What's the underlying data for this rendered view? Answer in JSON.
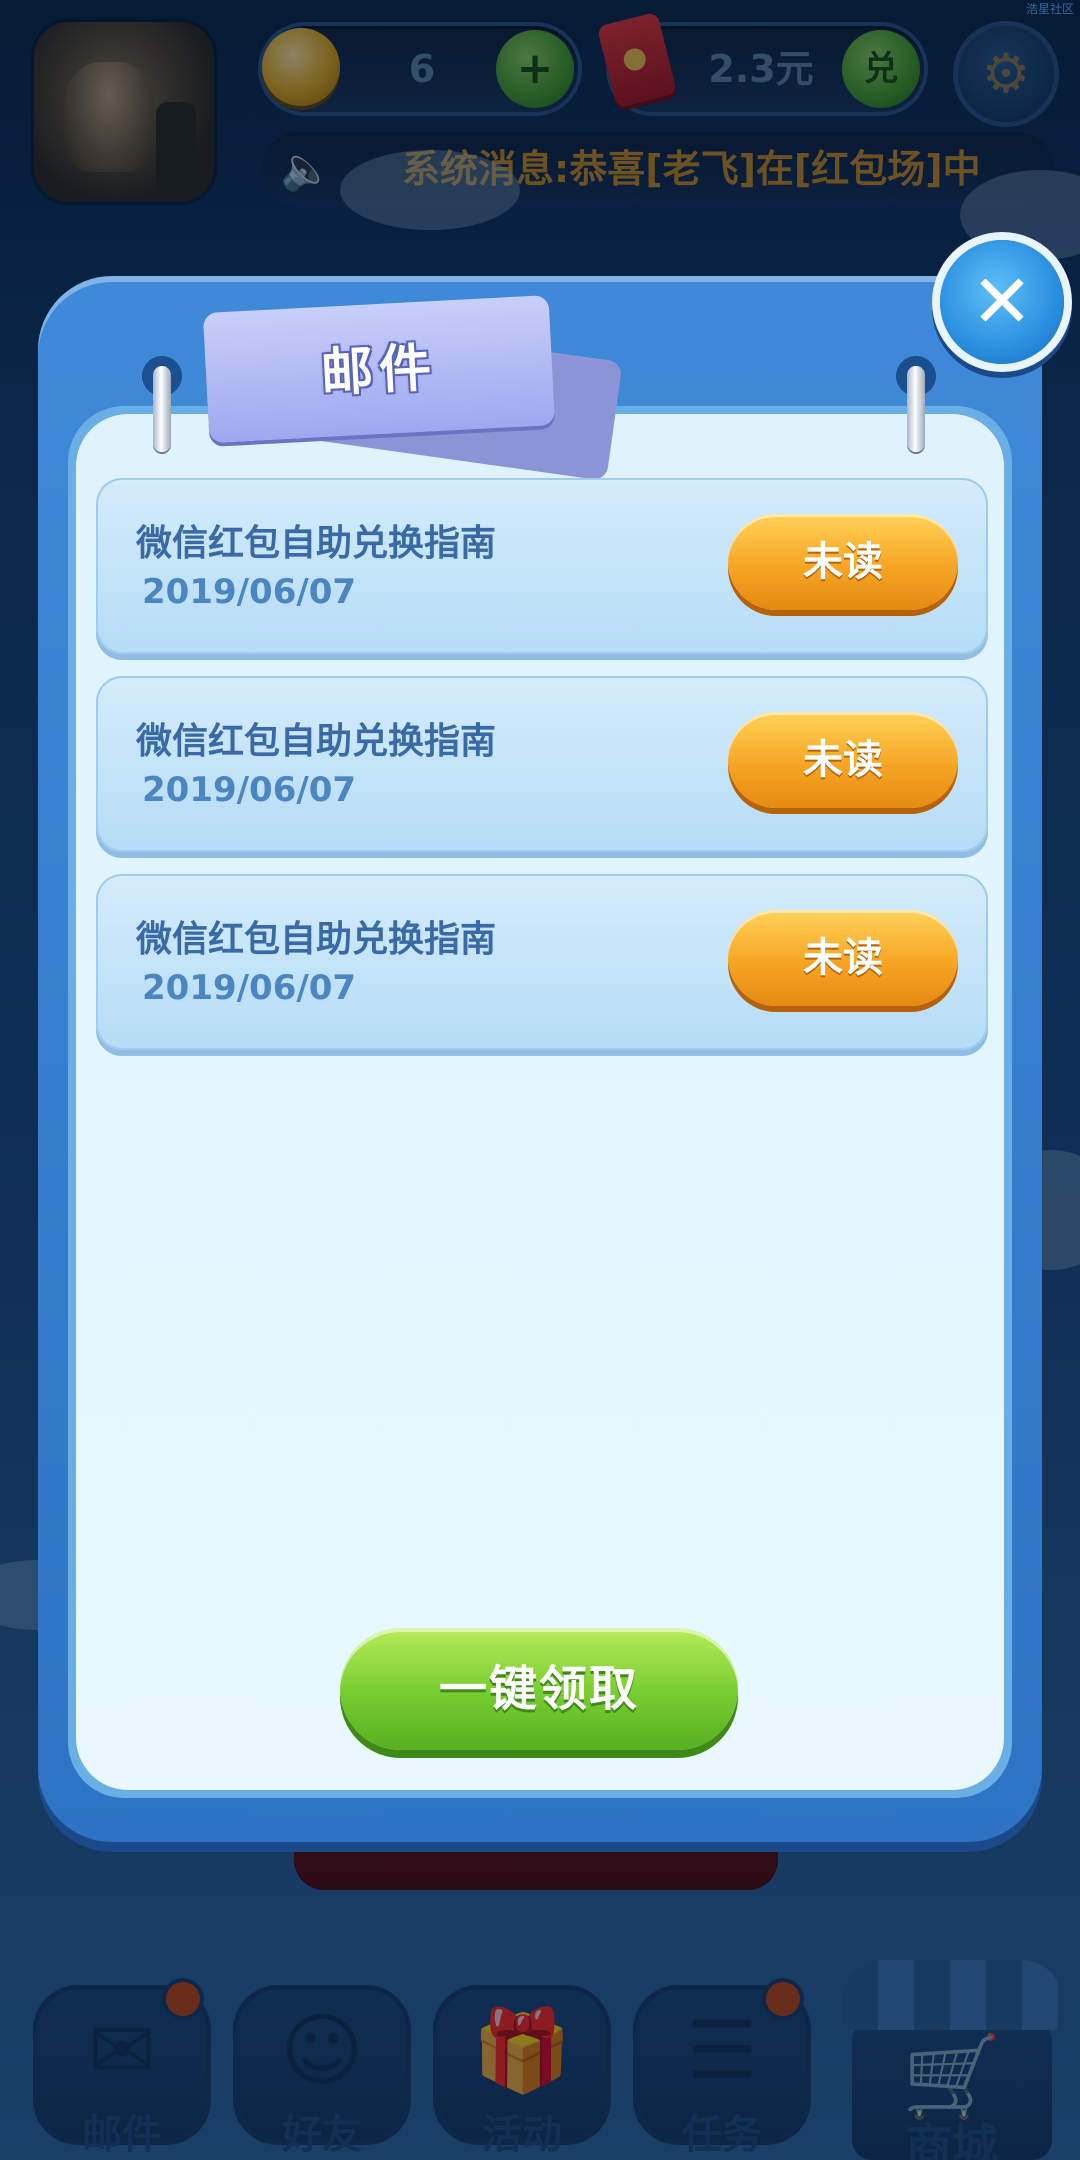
{
  "hud": {
    "coins": "6",
    "coins_add": "+",
    "money": "2.3元",
    "money_exchange": "兑",
    "settings_glyph": "⚙",
    "marquee_icon": "speaker-icon",
    "marquee_text": "系统消息:恭喜[老飞]在[红包场]中"
  },
  "watermark": "浩星社区",
  "modal": {
    "title": "邮件",
    "close_glyph": "✕",
    "mails": [
      {
        "title": "微信红包自助兑换指南",
        "date": "2019/06/07",
        "status": "未读"
      },
      {
        "title": "微信红包自助兑换指南",
        "date": "2019/06/07",
        "status": "未读"
      },
      {
        "title": "微信红包自助兑换指南",
        "date": "2019/06/07",
        "status": "未读"
      }
    ],
    "claim_all": "一键领取"
  },
  "bottom_nav": {
    "items": [
      {
        "label": "邮件",
        "icon": "mail-icon",
        "glyph": "✉",
        "badge": true
      },
      {
        "label": "好友",
        "icon": "friends-icon",
        "glyph": "☺",
        "badge": false
      },
      {
        "label": "活动",
        "icon": "gift-icon",
        "glyph": "🎁",
        "badge": false
      },
      {
        "label": "任务",
        "icon": "task-icon",
        "glyph": "☰",
        "badge": true
      }
    ],
    "shop": {
      "label": "商城",
      "icon": "cart-icon",
      "glyph": "🛒"
    }
  },
  "colors": {
    "panel_blue": "#2e73c3",
    "status_orange": "#f6a523",
    "claim_green": "#76cc2f",
    "mail_title": "#3a6aa6"
  }
}
